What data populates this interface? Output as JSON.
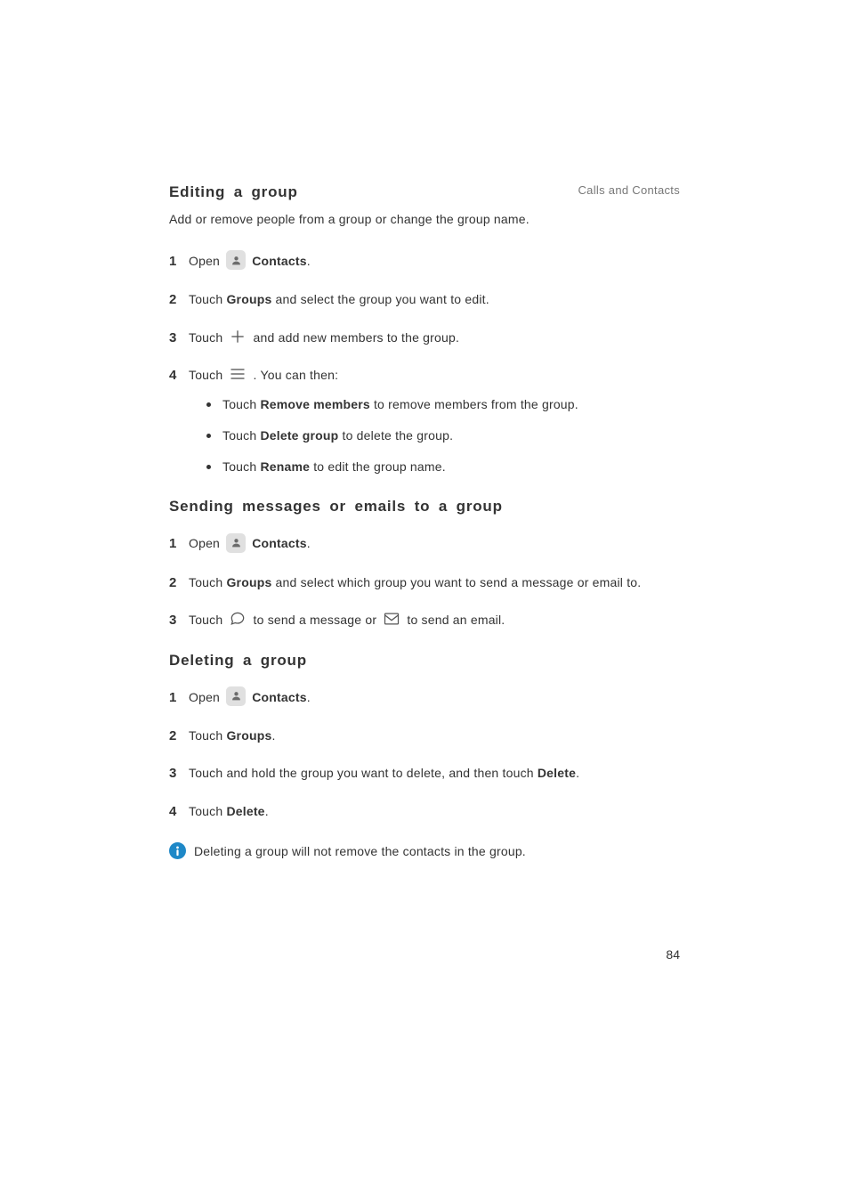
{
  "breadcrumb": "Calls and Contacts",
  "page_number": "84",
  "icons": {
    "contacts": "contacts-icon",
    "plus": "plus-icon",
    "menu": "menu-icon",
    "message": "message-icon",
    "email": "email-icon",
    "info": "info-icon"
  },
  "sectionA": {
    "title": "Editing a group",
    "intro": "Add or remove people from a group or change the group name.",
    "steps": {
      "s1": {
        "a": "Open ",
        "b": "Contacts",
        "c": "."
      },
      "s2": {
        "a": "Touch ",
        "b": "Groups",
        "c": " and select the group you want to edit."
      },
      "s3": {
        "a": "Touch ",
        "b": " and add new members to the group."
      },
      "s4": {
        "a": "Touch ",
        "b": " . You can then:"
      }
    },
    "bullets": {
      "b1": {
        "a": "Touch ",
        "b": "Remove members",
        "c": " to remove members from the group."
      },
      "b2": {
        "a": "Touch ",
        "b": "Delete group",
        "c": " to delete the group."
      },
      "b3": {
        "a": "Touch ",
        "b": "Rename",
        "c": " to edit the group name."
      }
    }
  },
  "sectionB": {
    "title": "Sending messages or emails to a group",
    "steps": {
      "s1": {
        "a": "Open ",
        "b": "Contacts",
        "c": "."
      },
      "s2": {
        "a": "Touch ",
        "b": "Groups",
        "c": " and select which group you want to send a message or email to."
      },
      "s3": {
        "a": "Touch ",
        "b": " to send a message or ",
        "c": " to send an email."
      }
    }
  },
  "sectionC": {
    "title": "Deleting a group",
    "steps": {
      "s1": {
        "a": "Open ",
        "b": "Contacts",
        "c": "."
      },
      "s2": {
        "a": "Touch ",
        "b": "Groups",
        "c": "."
      },
      "s3": {
        "a": "Touch and hold the group you want to delete, and then touch ",
        "b": "Delete",
        "c": "."
      },
      "s4": {
        "a": "Touch ",
        "b": "Delete",
        "c": "."
      }
    },
    "note": "Deleting a group will not remove the contacts in the group."
  }
}
